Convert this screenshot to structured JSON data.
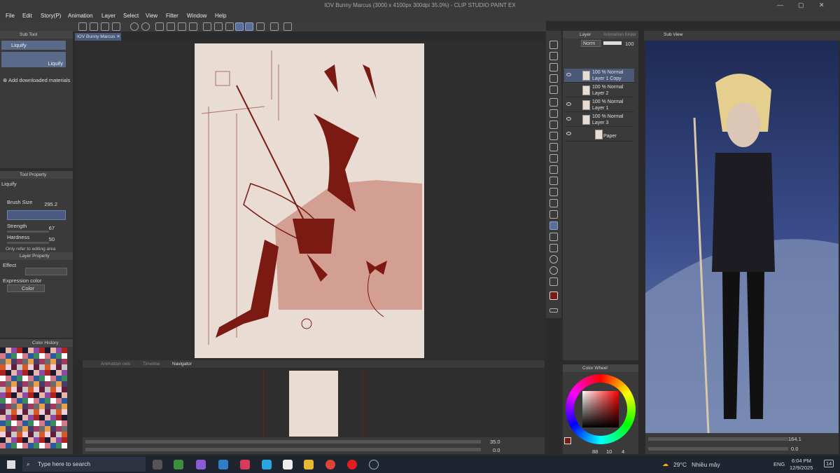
{
  "window": {
    "title": "IOV Bunny Marcus (3000 x 4100px 300dpi 35.0%) - CLIP STUDIO PAINT EX",
    "minimize": "—",
    "maximize": "▢",
    "close": "✕"
  },
  "menu": [
    "File",
    "Edit",
    "Story(P)",
    "Animation",
    "Layer",
    "Select",
    "View",
    "Filter",
    "Window",
    "Help"
  ],
  "document_tab": {
    "label": "IOV Bunny Marcus",
    "close": "✕"
  },
  "sub_tool": {
    "panel_title": "Sub Tool",
    "group_label": "Liquify",
    "item_label": "Liquify",
    "add_materials": "Add downloaded materials"
  },
  "tool_property": {
    "panel_title": "Tool Property",
    "tool_name": "Liquify",
    "brush_size_label": "Brush Size",
    "brush_size_value": "295.2",
    "strength_label": "Strength",
    "strength_value": "67",
    "hardness_label": "Hardness",
    "hardness_value": "50",
    "truncated_option": "Only refer to editing area"
  },
  "layer_property": {
    "panel_title": "Layer Property",
    "effect_label": "Effect",
    "expression_color_label": "Expression color",
    "expression_color_value": "Color"
  },
  "color_history": {
    "panel_title": "Color History"
  },
  "layer_panel": {
    "tab_layer": "Layer",
    "tab_other": "Animation folder",
    "blend_mode": "Norm",
    "opacity": "100",
    "layers": [
      {
        "blend": "100 % Normal",
        "name": "Layer 1 Copy",
        "selected": true
      },
      {
        "blend": "100 % Normal",
        "name": "Layer 2",
        "selected": false
      },
      {
        "blend": "100 % Normal",
        "name": "Layer 1",
        "selected": false
      },
      {
        "blend": "100 % Normal",
        "name": "Layer 3",
        "selected": false
      },
      {
        "blend": "",
        "name": "Paper",
        "selected": false
      }
    ]
  },
  "bottom_tabs": [
    "Animation cels",
    "Timeline",
    "Navigator"
  ],
  "navigator": {
    "zoom": "35.0",
    "rotation": "0.0"
  },
  "sub_view": {
    "panel_title": "Sub View",
    "zoom": "164.1",
    "rotation": "0.0"
  },
  "color_wheel": {
    "panel_title": "Color Wheel",
    "r": "88",
    "g": "10",
    "b": "4"
  },
  "colors": {
    "main_color": "#7a1a12",
    "brand_accent": "#5b6e9a",
    "paper": "#e9dcd2",
    "sketch": "#7a1f1a"
  },
  "taskbar": {
    "search_placeholder": "Type here to search",
    "weather_temp": "29°C",
    "weather_desc": "Nhiều mây",
    "lang": "ENG",
    "time": "6:04 PM",
    "date": "12/9/2025",
    "notifications": "14"
  }
}
